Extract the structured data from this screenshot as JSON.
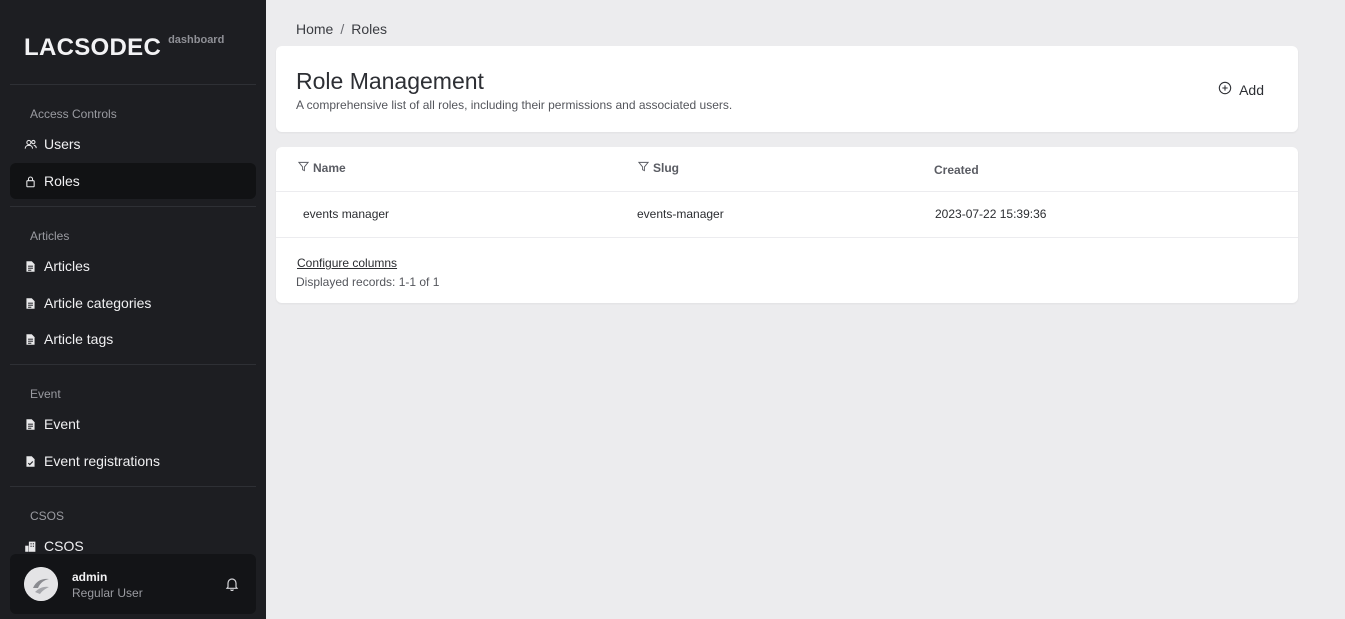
{
  "brand": {
    "name": "LACSODEC",
    "sub": "dashboard"
  },
  "sidebar": {
    "sections": [
      {
        "title": "Access Controls"
      },
      {
        "title": "Articles"
      },
      {
        "title": "Event"
      },
      {
        "title": "CSOS"
      }
    ],
    "items": [
      {
        "label": "Users",
        "icon": "users-icon",
        "active": false
      },
      {
        "label": "Roles",
        "icon": "lock-icon",
        "active": true
      },
      {
        "label": "Articles",
        "icon": "document-icon",
        "active": false
      },
      {
        "label": "Article categories",
        "icon": "document-icon",
        "active": false
      },
      {
        "label": "Article tags",
        "icon": "document-icon",
        "active": false
      },
      {
        "label": "Event",
        "icon": "document-icon",
        "active": false
      },
      {
        "label": "Event registrations",
        "icon": "document-check-icon",
        "active": false
      },
      {
        "label": "CSOS",
        "icon": "building-icon",
        "active": false
      }
    ]
  },
  "user": {
    "name": "admin",
    "role": "Regular User"
  },
  "breadcrumb": {
    "home": "Home",
    "separator": "/",
    "current": "Roles"
  },
  "header": {
    "title": "Role Management",
    "description": "A comprehensive list of all roles, including their permissions and associated users.",
    "add_label": "Add"
  },
  "table": {
    "columns": [
      "Name",
      "Slug",
      "Created"
    ],
    "rows": [
      {
        "name": "events manager",
        "slug": "events-manager",
        "created": "2023-07-22 15:39:36"
      }
    ],
    "configure_label": "Configure columns",
    "records_label": "Displayed records: 1-1 of 1"
  },
  "colors": {
    "sidebar_bg": "#1d1e22",
    "active_item_bg": "#111214",
    "page_bg": "#ececee"
  }
}
